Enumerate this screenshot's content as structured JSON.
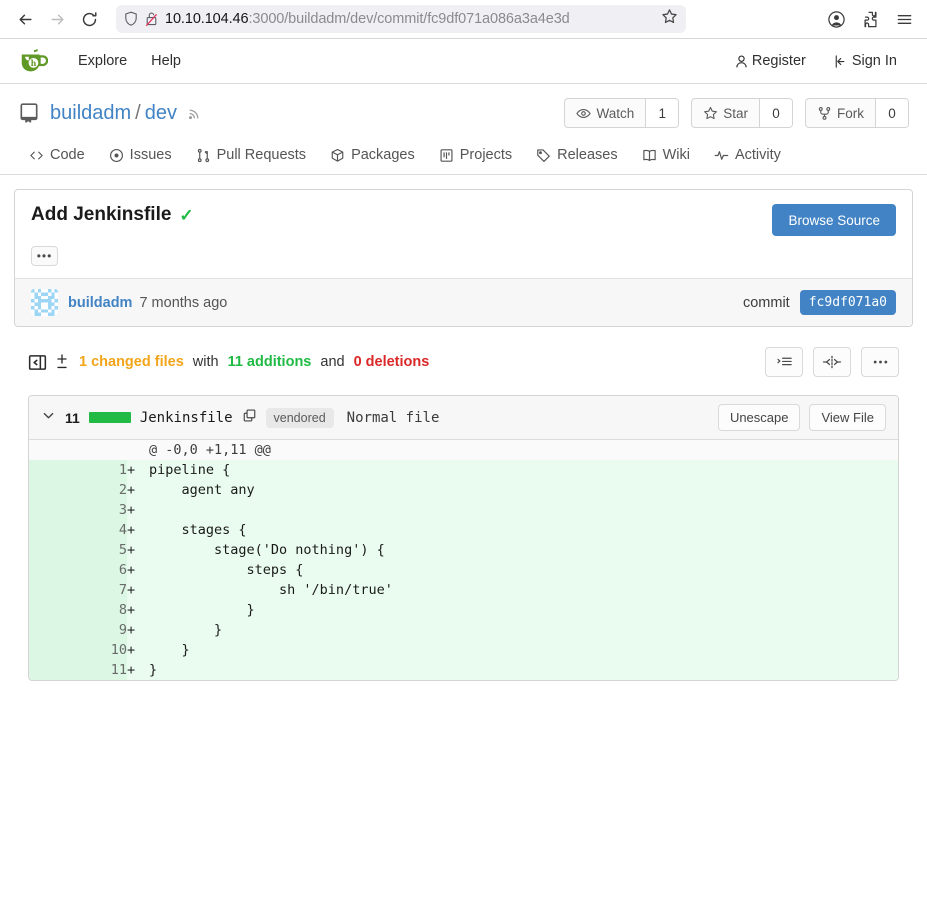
{
  "browser": {
    "back_icon": "arrow-left-icon",
    "forward_icon": "arrow-right-icon",
    "reload_icon": "reload-icon",
    "shield_icon": "shield-icon",
    "lock_broken_icon": "lock-broken-icon",
    "url_host": "10.10.104.46",
    "url_path": ":3000/buildadm/dev/commit/fc9df071a086a3a4e3d",
    "bookmark_icon": "star-icon",
    "account_icon": "account-icon",
    "extensions_icon": "puzzle-piece-icon",
    "menu_icon": "hamburger-menu-icon"
  },
  "gitea_nav": {
    "logo": "gitea-logo",
    "links": [
      "Explore",
      "Help"
    ],
    "register": "Register",
    "sign_in": "Sign In"
  },
  "repo": {
    "icon": "repository-icon",
    "owner": "buildadm",
    "separator": "/",
    "name": "dev",
    "rss_icon": "rss-icon",
    "actions": [
      {
        "label": "Watch",
        "count": "1",
        "icon": "eye-icon"
      },
      {
        "label": "Star",
        "count": "0",
        "icon": "star-icon"
      },
      {
        "label": "Fork",
        "count": "0",
        "icon": "fork-icon"
      }
    ],
    "tabs": [
      {
        "label": "Code",
        "icon": "code-icon"
      },
      {
        "label": "Issues",
        "icon": "issue-opened-icon"
      },
      {
        "label": "Pull Requests",
        "icon": "git-pull-request-icon"
      },
      {
        "label": "Packages",
        "icon": "package-icon"
      },
      {
        "label": "Projects",
        "icon": "project-icon"
      },
      {
        "label": "Releases",
        "icon": "tag-icon"
      },
      {
        "label": "Wiki",
        "icon": "book-icon"
      },
      {
        "label": "Activity",
        "icon": "pulse-icon"
      }
    ]
  },
  "commit": {
    "title": "Add Jenkinsfile",
    "status_icon": "check-mark-icon",
    "browse_source": "Browse Source",
    "ellipsis": "•••",
    "author": "buildadm",
    "when": "7 months ago",
    "commit_label": "commit",
    "sha": "fc9df071a0"
  },
  "diff_summary": {
    "collapse_icon": "sidebar-collapse-icon",
    "plusminus_icon": "plus-minus-icon",
    "files_changed": "1 changed files",
    "with_text": "with",
    "additions": "11 additions",
    "and_text": "and",
    "deletions": "0 deletions",
    "tools": [
      {
        "icon": "diff-options-icon"
      },
      {
        "icon": "split-view-icon"
      },
      {
        "icon": "more-options-icon"
      }
    ]
  },
  "file": {
    "chevron_icon": "chevron-down-icon",
    "change_count": "11",
    "name": "Jenkinsfile",
    "copy_icon": "copy-icon",
    "badge": "vendored",
    "kind": "Normal file",
    "unescape": "Unescape",
    "view_file": "View File",
    "hunk_header": "@ -0,0 +1,11 @@",
    "lines": [
      {
        "num": "1",
        "marker": "+",
        "code": "pipeline {"
      },
      {
        "num": "2",
        "marker": "+",
        "code": "    agent any"
      },
      {
        "num": "3",
        "marker": "+",
        "code": ""
      },
      {
        "num": "4",
        "marker": "+",
        "code": "    stages {"
      },
      {
        "num": "5",
        "marker": "+",
        "code": "        stage('Do nothing') {"
      },
      {
        "num": "6",
        "marker": "+",
        "code": "            steps {"
      },
      {
        "num": "7",
        "marker": "+",
        "code": "                sh '/bin/true'"
      },
      {
        "num": "8",
        "marker": "+",
        "code": "            }"
      },
      {
        "num": "9",
        "marker": "+",
        "code": "        }"
      },
      {
        "num": "10",
        "marker": "+",
        "code": "    }"
      },
      {
        "num": "11",
        "marker": "+",
        "code": "}"
      }
    ]
  },
  "colors": {
    "accent_blue": "#4183c4",
    "green": "#21ba45",
    "orange": "#f2a51a",
    "red": "#db2828",
    "diff_add_bg": "#e9fcef"
  }
}
